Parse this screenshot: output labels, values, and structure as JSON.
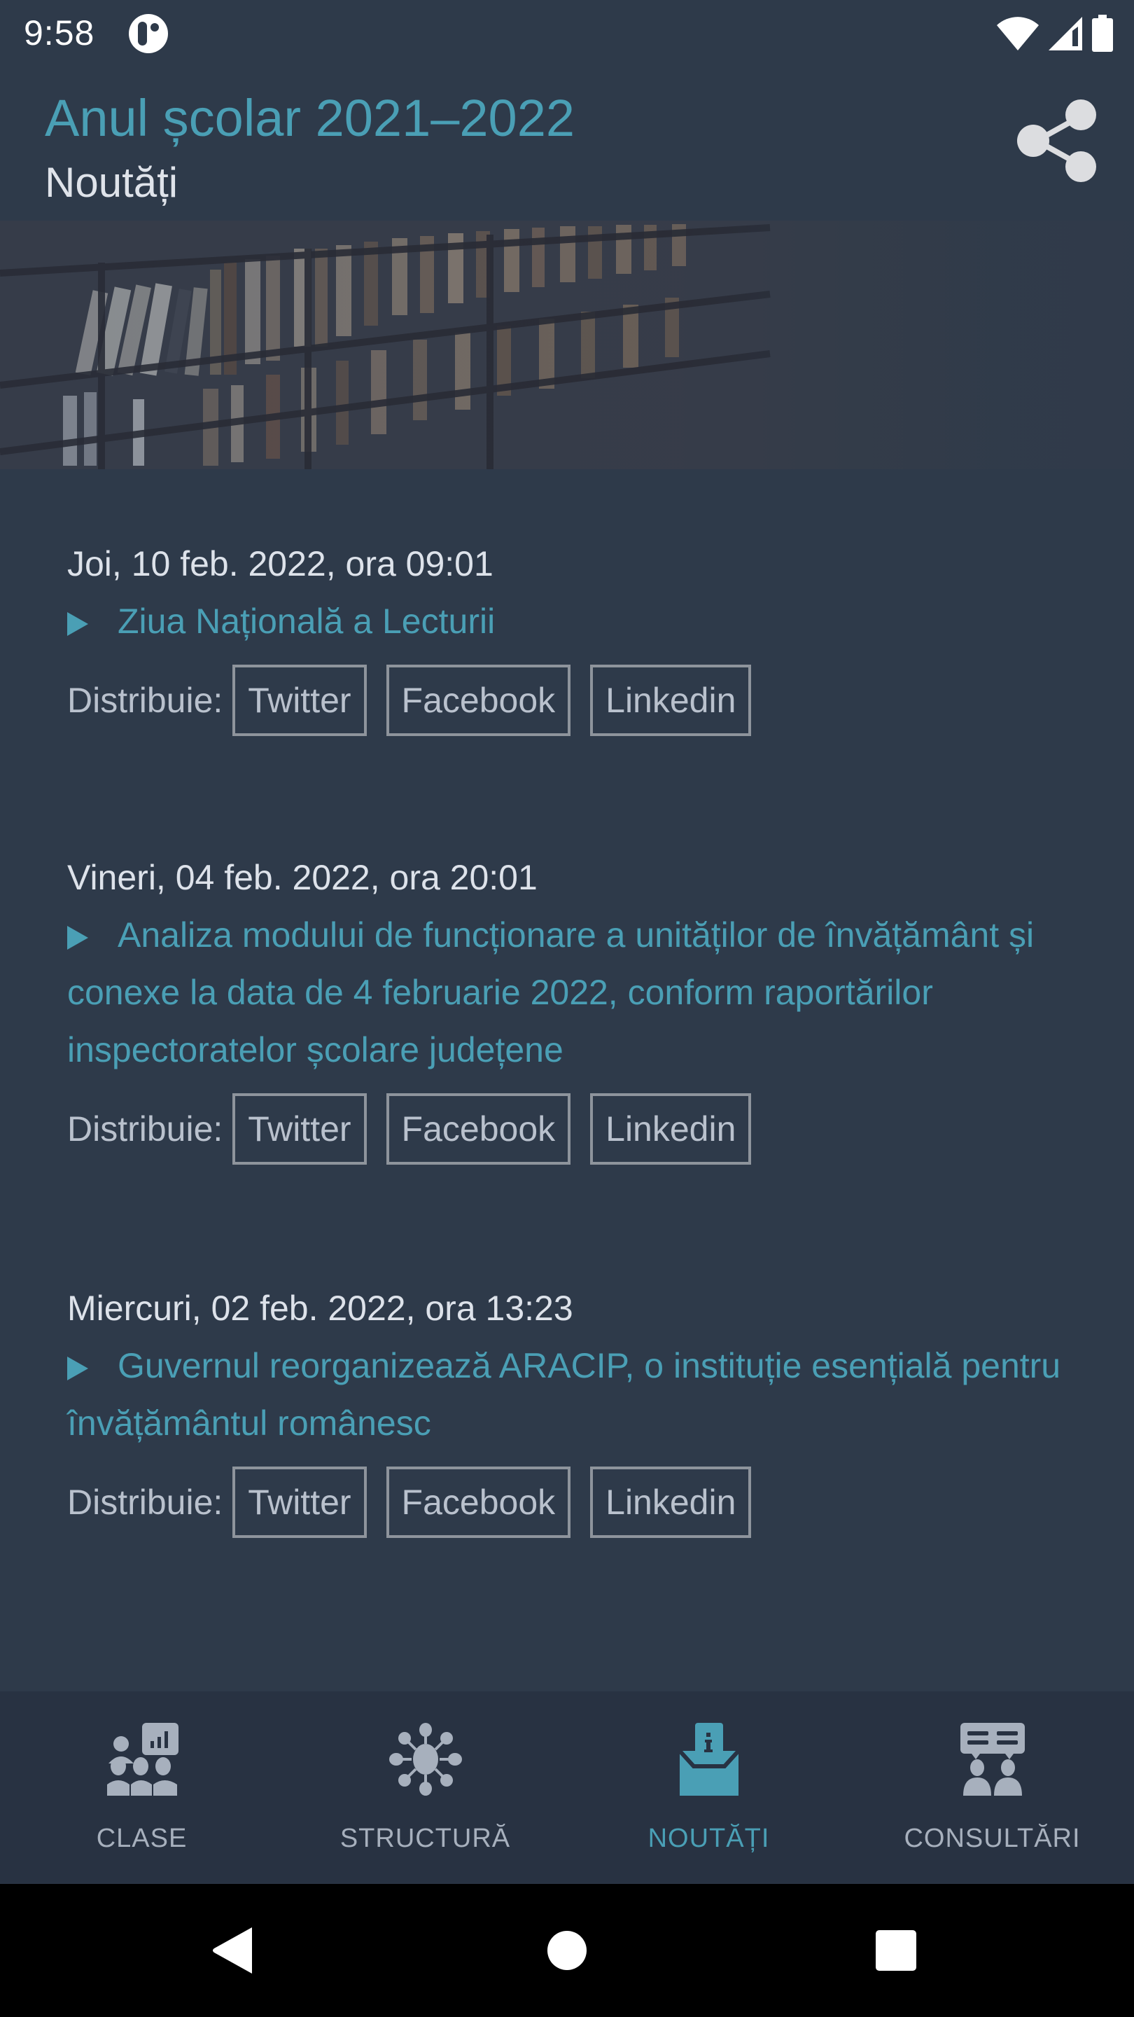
{
  "status_bar": {
    "time": "9:58",
    "app_notification_icon": "app-logo-icon",
    "icons": [
      "wifi-icon",
      "cellular-signal-icon",
      "battery-icon"
    ]
  },
  "app_bar": {
    "title": "Anul școlar 2021–2022",
    "subtitle": "Noutăți",
    "share_icon": "share-icon"
  },
  "banner": {
    "image": "library-bookshelves-photo"
  },
  "news": {
    "share_label": "Distribuie:",
    "share_targets": [
      "Twitter",
      "Facebook",
      "Linkedin"
    ],
    "items": [
      {
        "date": "Joi, 10 feb. 2022, ora 09:01",
        "title": "Ziua Națională a Lecturii"
      },
      {
        "date": "Vineri, 04 feb. 2022, ora 20:01",
        "title": "Analiza modului de funcționare a unităților de învățământ și conexe la data de 4 februarie 2022, conform raportărilor inspectoratelor școlare județene"
      },
      {
        "date": "Miercuri, 02 feb. 2022, ora 13:23",
        "title": "Guvernul reorganizează ARACIP, o instituție esențială pentru învățământul românesc"
      }
    ]
  },
  "bottom_nav": {
    "items": [
      {
        "label": "CLASE",
        "icon": "classroom-icon",
        "active": false
      },
      {
        "label": "STRUCTURĂ",
        "icon": "network-structure-icon",
        "active": false
      },
      {
        "label": "NOUTĂȚI",
        "icon": "news-envelope-icon",
        "active": true
      },
      {
        "label": "CONSULTĂRI",
        "icon": "consultation-icon",
        "active": false
      }
    ]
  },
  "system_nav": {
    "buttons": [
      "back-icon",
      "home-icon",
      "recents-icon"
    ]
  },
  "colors": {
    "accent": "#4a9fb5",
    "background": "#2e3a4a",
    "nav_background": "#283242",
    "inactive": "#a7b0bd",
    "text": "#dde2ea"
  }
}
